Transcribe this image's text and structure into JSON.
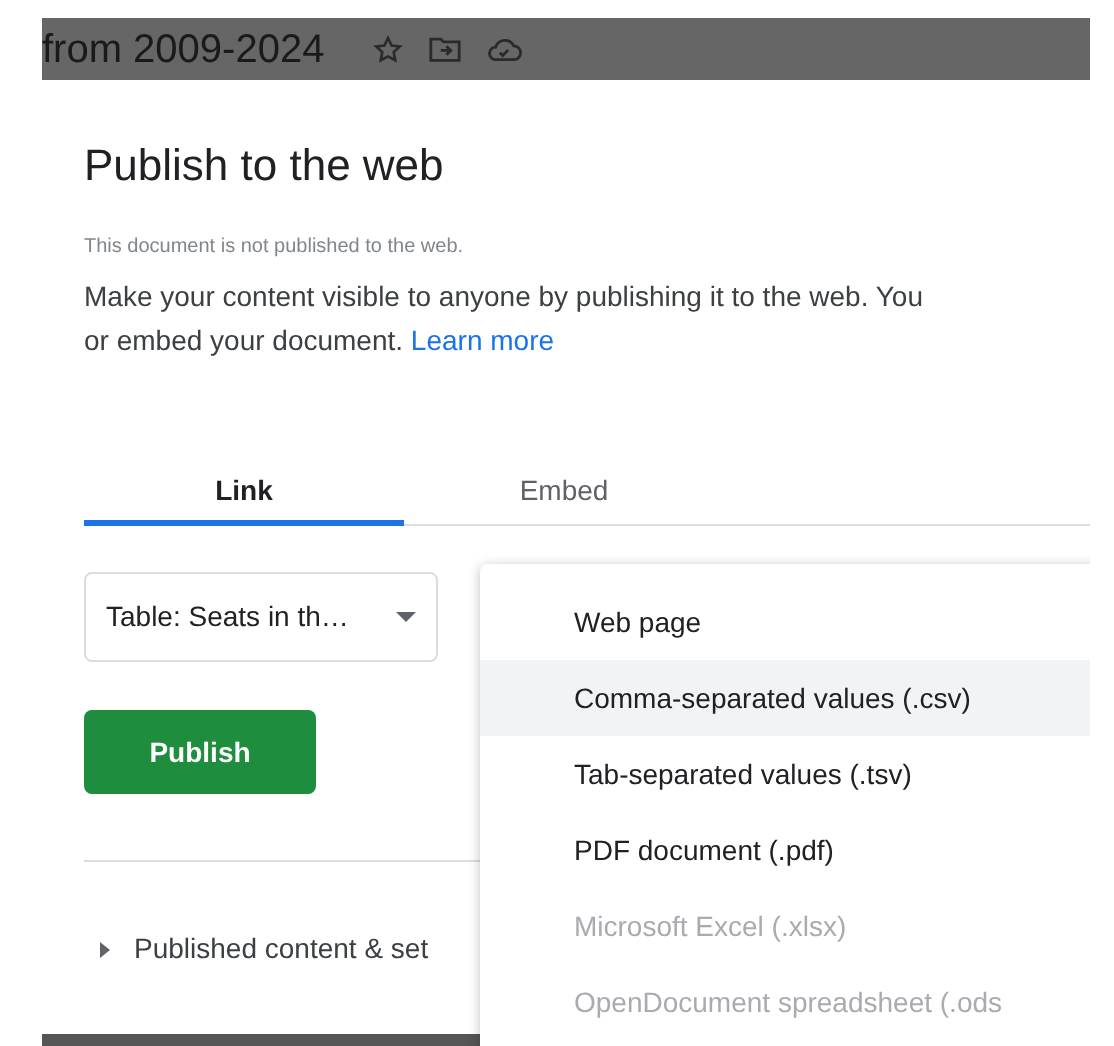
{
  "doc_bar": {
    "title": "from 2009-2024"
  },
  "dialog": {
    "title": "Publish to the web",
    "status": "This document is not published to the web.",
    "description_lines": [
      "Make your content visible to anyone by publishing it to the web. You",
      "or embed your document."
    ],
    "link": "Learn more"
  },
  "tabs": [
    {
      "label": "Link",
      "selected": true
    },
    {
      "label": "Embed",
      "selected": false
    }
  ],
  "sheet_select": {
    "value": "Table: Seats in th…"
  },
  "publish_button": "Publish",
  "published_section": {
    "label": "Published content & set",
    "expanded": false
  },
  "format_menu": [
    {
      "label": "Web page",
      "selected": false,
      "disabled": false
    },
    {
      "label": "Comma-separated values (.csv)",
      "selected": true,
      "disabled": false
    },
    {
      "label": "Tab-separated values (.tsv)",
      "selected": false,
      "disabled": false
    },
    {
      "label": "PDF document (.pdf)",
      "selected": false,
      "disabled": false
    },
    {
      "label": "Microsoft Excel (.xlsx)",
      "selected": false,
      "disabled": true
    },
    {
      "label": "OpenDocument spreadsheet (.ods",
      "selected": false,
      "disabled": true
    }
  ]
}
